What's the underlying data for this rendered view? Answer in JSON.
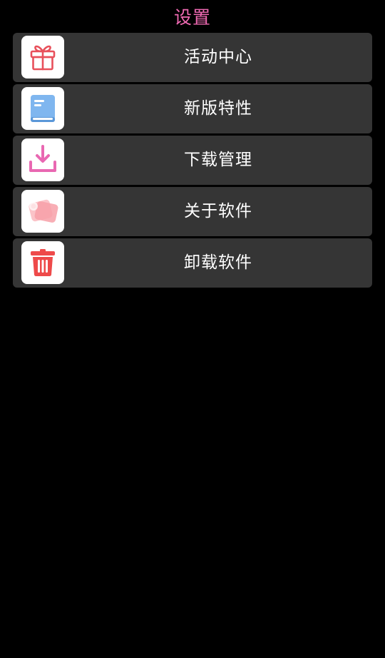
{
  "header": {
    "title": "设置",
    "title_color": "#f06ab3"
  },
  "theme": {
    "background": "#000000",
    "item_background": "#353535",
    "icon_background": "#ffffff",
    "label_color": "#ffffff"
  },
  "menu": {
    "items": [
      {
        "label": "活动中心",
        "icon": "gift-icon",
        "icon_color": "#e8505b"
      },
      {
        "label": "新版特性",
        "icon": "book-icon",
        "icon_color": "#7fb6ef"
      },
      {
        "label": "下载管理",
        "icon": "download-icon",
        "icon_color": "#e968b2"
      },
      {
        "label": "关于软件",
        "icon": "info-card-icon",
        "icon_color": "#f7a0a8"
      },
      {
        "label": "卸载软件",
        "icon": "trash-icon",
        "icon_color": "#ee4a4a"
      }
    ]
  }
}
